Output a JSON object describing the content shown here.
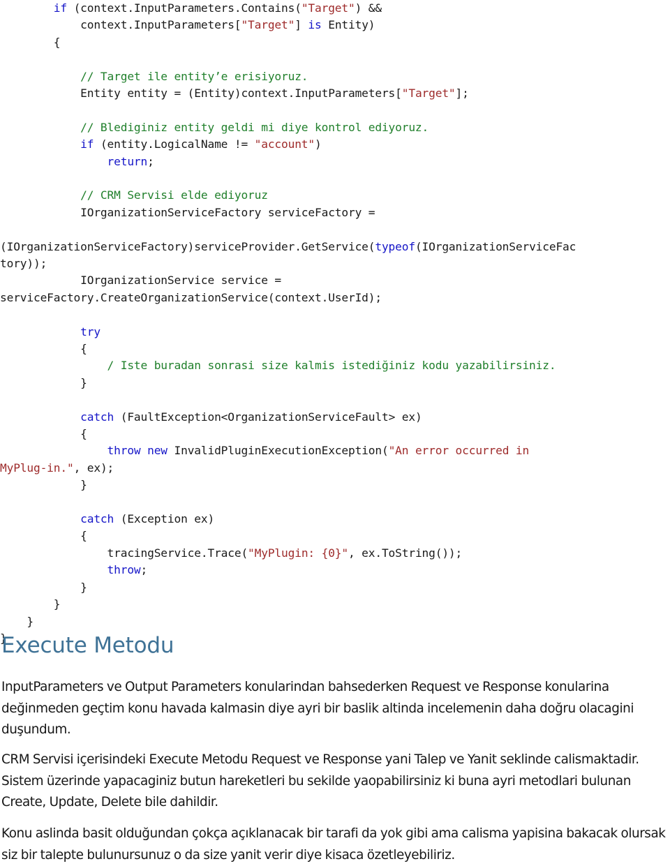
{
  "document": {
    "code_block": {
      "language": "csharp",
      "colors": {
        "keyword": "#1616c8",
        "string": "#9e2b2b",
        "comment": "#21802c",
        "plain": "#1a1a1a"
      },
      "lines": [
        {
          "id": "l1",
          "segments": [
            {
              "t": "kw",
              "v": "        if"
            },
            {
              "t": "pln",
              "v": " (context.InputParameters.Contains("
            },
            {
              "t": "str",
              "v": "\"Target\""
            },
            {
              "t": "pln",
              "v": ") &&"
            }
          ]
        },
        {
          "id": "l2",
          "segments": [
            {
              "t": "pln",
              "v": "            context.InputParameters["
            },
            {
              "t": "str",
              "v": "\"Target\""
            },
            {
              "t": "pln",
              "v": "] "
            },
            {
              "t": "kw",
              "v": "is"
            },
            {
              "t": "pln",
              "v": " Entity)"
            }
          ]
        },
        {
          "id": "l3",
          "segments": [
            {
              "t": "pln",
              "v": "        {"
            }
          ]
        },
        {
          "id": "l4",
          "segments": [
            {
              "t": "pln",
              "v": ""
            }
          ]
        },
        {
          "id": "l5",
          "segments": [
            {
              "t": "cmt",
              "v": "            // Target ile entity’e erisiyoruz."
            }
          ]
        },
        {
          "id": "l6",
          "segments": [
            {
              "t": "pln",
              "v": "            Entity entity = (Entity)context.InputParameters["
            },
            {
              "t": "str",
              "v": "\"Target\""
            },
            {
              "t": "pln",
              "v": "];"
            }
          ]
        },
        {
          "id": "l7",
          "segments": [
            {
              "t": "pln",
              "v": ""
            }
          ]
        },
        {
          "id": "l8",
          "segments": [
            {
              "t": "cmt",
              "v": "            // Blediginiz entity geldi mi diye kontrol ediyoruz."
            }
          ]
        },
        {
          "id": "l9",
          "segments": [
            {
              "t": "kw",
              "v": "            if"
            },
            {
              "t": "pln",
              "v": " (entity.LogicalName != "
            },
            {
              "t": "str",
              "v": "\"account\""
            },
            {
              "t": "pln",
              "v": ")"
            }
          ]
        },
        {
          "id": "l10",
          "segments": [
            {
              "t": "kw",
              "v": "                return"
            },
            {
              "t": "pln",
              "v": ";"
            }
          ]
        },
        {
          "id": "l11",
          "segments": [
            {
              "t": "pln",
              "v": ""
            }
          ]
        },
        {
          "id": "l12",
          "segments": [
            {
              "t": "cmt",
              "v": "            // CRM Servisi elde ediyoruz"
            }
          ]
        },
        {
          "id": "l13",
          "segments": [
            {
              "t": "pln",
              "v": "            IOrganizationServiceFactory serviceFactory ="
            }
          ]
        },
        {
          "id": "l14",
          "segments": [
            {
              "t": "pln",
              "v": ""
            }
          ]
        },
        {
          "id": "l15",
          "segments": [
            {
              "t": "pln",
              "v": "(IOrganizationServiceFactory)serviceProvider.GetService("
            },
            {
              "t": "kw",
              "v": "typeof"
            },
            {
              "t": "pln",
              "v": "(IOrganizationServiceFac"
            }
          ]
        },
        {
          "id": "l16",
          "segments": [
            {
              "t": "pln",
              "v": "tory));"
            }
          ]
        },
        {
          "id": "l17",
          "segments": [
            {
              "t": "pln",
              "v": "            IOrganizationService service ="
            }
          ]
        },
        {
          "id": "l18",
          "segments": [
            {
              "t": "pln",
              "v": "serviceFactory.CreateOrganizationService(context.UserId);"
            }
          ]
        },
        {
          "id": "l19",
          "segments": [
            {
              "t": "pln",
              "v": ""
            }
          ]
        },
        {
          "id": "l20",
          "segments": [
            {
              "t": "kw",
              "v": "            try"
            }
          ]
        },
        {
          "id": "l21",
          "segments": [
            {
              "t": "pln",
              "v": "            {"
            }
          ]
        },
        {
          "id": "l22",
          "segments": [
            {
              "t": "cmt",
              "v": "                / Iste buradan sonrasi size kalmis istediğiniz kodu yazabilirsiniz."
            }
          ]
        },
        {
          "id": "l23",
          "segments": [
            {
              "t": "pln",
              "v": "            }"
            }
          ]
        },
        {
          "id": "l24",
          "segments": [
            {
              "t": "pln",
              "v": ""
            }
          ]
        },
        {
          "id": "l25",
          "segments": [
            {
              "t": "kw",
              "v": "            catch"
            },
            {
              "t": "pln",
              "v": " (FaultException<OrganizationServiceFault> ex)"
            }
          ]
        },
        {
          "id": "l26",
          "segments": [
            {
              "t": "pln",
              "v": "            {"
            }
          ]
        },
        {
          "id": "l27",
          "segments": [
            {
              "t": "kw",
              "v": "                throw new"
            },
            {
              "t": "pln",
              "v": " InvalidPluginExecutionException("
            },
            {
              "t": "str",
              "v": "\"An error occurred in"
            }
          ]
        },
        {
          "id": "l28",
          "segments": [
            {
              "t": "str",
              "v": "MyPlug-in.\""
            },
            {
              "t": "pln",
              "v": ", ex);"
            }
          ]
        },
        {
          "id": "l29",
          "segments": [
            {
              "t": "pln",
              "v": "            }"
            }
          ]
        },
        {
          "id": "l30",
          "segments": [
            {
              "t": "pln",
              "v": ""
            }
          ]
        },
        {
          "id": "l31",
          "segments": [
            {
              "t": "kw",
              "v": "            catch"
            },
            {
              "t": "pln",
              "v": " (Exception ex)"
            }
          ]
        },
        {
          "id": "l32",
          "segments": [
            {
              "t": "pln",
              "v": "            {"
            }
          ]
        },
        {
          "id": "l33",
          "segments": [
            {
              "t": "pln",
              "v": "                tracingService.Trace("
            },
            {
              "t": "str",
              "v": "\"MyPlugin: {0}\""
            },
            {
              "t": "pln",
              "v": ", ex.ToString());"
            }
          ]
        },
        {
          "id": "l34",
          "segments": [
            {
              "t": "kw",
              "v": "                throw"
            },
            {
              "t": "pln",
              "v": ";"
            }
          ]
        },
        {
          "id": "l35",
          "segments": [
            {
              "t": "pln",
              "v": "            }"
            }
          ]
        },
        {
          "id": "l36",
          "segments": [
            {
              "t": "pln",
              "v": "        }"
            }
          ]
        },
        {
          "id": "l37",
          "segments": [
            {
              "t": "pln",
              "v": "    }"
            }
          ]
        },
        {
          "id": "l38",
          "segments": [
            {
              "t": "pln",
              "v": "}"
            }
          ]
        }
      ]
    },
    "heading": {
      "text": "Execute Metodu",
      "color": "#3f7296"
    },
    "paragraphs": [
      {
        "id": "para-1",
        "text": "InputParameters ve Output Parameters konularindan bahsederken Request ve Response konularina değinmeden geçtim konu havada kalmasin diye ayri bir baslik altinda incelemenin daha doğru olacagini duşundum."
      },
      {
        "id": "para-2",
        "text": "CRM Servisi içerisindeki Execute Metodu Request ve Response yani Talep ve Yanit seklinde calismaktadir. Sistem üzerinde yapacaginiz butun hareketleri bu sekilde yaopabilirsiniz ki buna ayri metodlari bulunan Create, Update, Delete bile dahildir."
      },
      {
        "id": "para-3",
        "text": "Konu aslinda basit olduğundan çokça açıklanacak bir tarafi da yok gibi ama calisma yapisina bakacak olursak siz bir talepte bulunursunuz o da size yanit verir diye kisaca özetleyebiliriz."
      }
    ]
  }
}
